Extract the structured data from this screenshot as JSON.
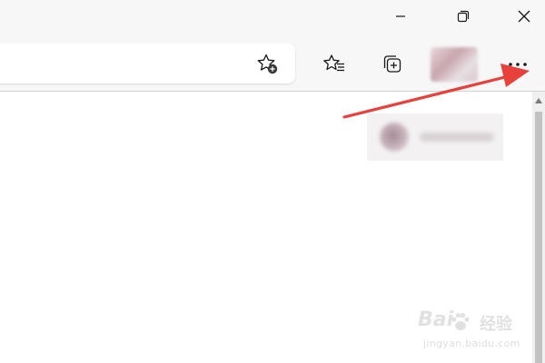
{
  "window": {
    "controls": [
      {
        "name": "minimize",
        "icon": "minimize-icon"
      },
      {
        "name": "restore",
        "icon": "restore-icon"
      },
      {
        "name": "close",
        "icon": "close-icon"
      }
    ]
  },
  "toolbar": {
    "address": {
      "value": "",
      "placeholder": ""
    },
    "buttons": [
      {
        "name": "add-to-favorites",
        "icon": "star-plus-icon"
      },
      {
        "name": "favorites",
        "icon": "star-list-icon"
      },
      {
        "name": "collections",
        "icon": "collections-icon"
      },
      {
        "name": "profile",
        "icon": "avatar"
      },
      {
        "name": "settings-and-more",
        "icon": "more-icon"
      }
    ]
  },
  "annotation": {
    "type": "arrow",
    "color": "#e8413c",
    "target": "settings-and-more"
  },
  "watermark": {
    "brand_latin": "Bai",
    "brand_cjk": "经验",
    "domain": "jingyan.baidu.com",
    "color": "#c9c9c9"
  },
  "colors": {
    "chrome_bg": "#f7f7f7",
    "content_bg": "#ffffff",
    "icon": "#1a1a1a",
    "scrollbar_thumb": "#c2c2c2"
  }
}
